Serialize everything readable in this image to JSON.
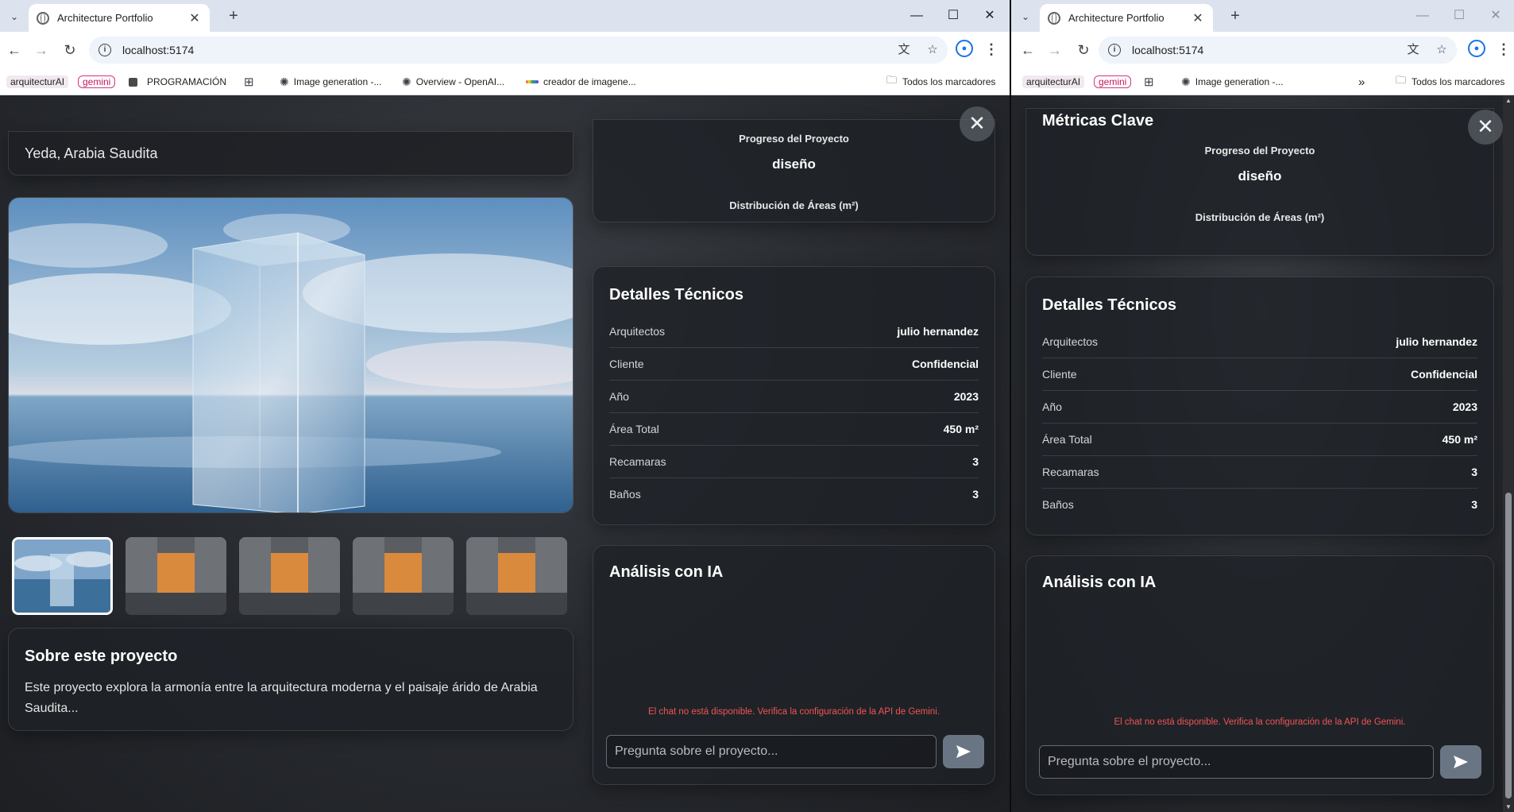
{
  "browser": {
    "tab_title": "Architecture Portfolio",
    "url": "localhost:5174",
    "bookmarks_left": [
      {
        "label": "arquitecturAI",
        "style": "chip"
      },
      {
        "label": "gemini",
        "style": "pink"
      },
      {
        "label": "PROGRAMACIÓN",
        "style": "square"
      },
      {
        "label": "Image generation -...",
        "style": "openai"
      },
      {
        "label": "Overview - OpenAI...",
        "style": "openai"
      },
      {
        "label": "creador de imagene...",
        "style": "rainbow"
      }
    ],
    "bookmarks_right": [
      {
        "label": "arquitecturAI",
        "style": "chip"
      },
      {
        "label": "gemini",
        "style": "pink"
      },
      {
        "label": "Image generation -...",
        "style": "openai"
      }
    ],
    "all_bookmarks": "Todos los marcadores",
    "overflow_glyph": "»"
  },
  "project": {
    "location": "Yeda, Arabia Saudita",
    "about_title": "Sobre este proyecto",
    "about_text": "Este proyecto explora la armonía entre la arquitectura moderna y el paisaje árido de Arabia Saudita...",
    "thumbnails": [
      "glass-cube",
      "concrete-courtyard",
      "concrete-courtyard",
      "concrete-courtyard",
      "concrete-courtyard"
    ]
  },
  "metrics": {
    "title": "Métricas Clave",
    "progress_label": "Progreso del Proyecto",
    "progress_value": "diseño",
    "areas_label": "Distribución de Áreas (m²)"
  },
  "details": {
    "title": "Detalles Técnicos",
    "rows": [
      {
        "label": "Arquitectos",
        "value": "julio hernandez"
      },
      {
        "label": "Cliente",
        "value": "Confidencial"
      },
      {
        "label": "Año",
        "value": "2023"
      },
      {
        "label": "Área Total",
        "value": "450 m²"
      },
      {
        "label": "Recamaras",
        "value": "3"
      },
      {
        "label": "Baños",
        "value": "3"
      }
    ]
  },
  "ai": {
    "title": "Análisis con IA",
    "error": "El chat no está disponible. Verifica la configuración de la API de Gemini.",
    "placeholder": "Pregunta sobre el proyecto..."
  },
  "icons": {
    "close": "✕",
    "send": "send-icon",
    "back": "arrow-left-icon",
    "forward": "arrow-right-icon",
    "reload": "reload-icon"
  }
}
